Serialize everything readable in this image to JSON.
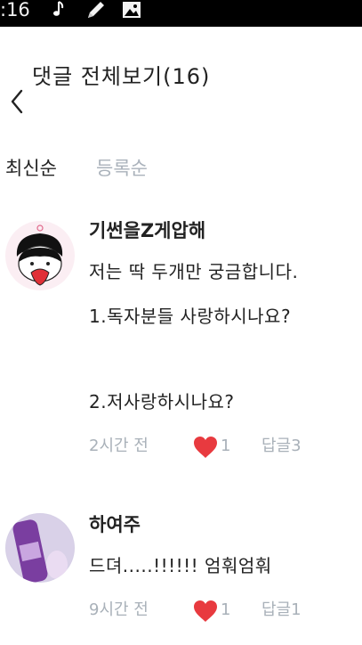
{
  "status_bar": {
    "time": ":16",
    "icons": [
      "music-note-icon",
      "pencil-icon",
      "image-icon"
    ]
  },
  "header": {
    "title": "댓글 전체보기(16)",
    "back_icon": "chevron-left-icon"
  },
  "sort_tabs": {
    "latest": "최신순",
    "registered": "등록순",
    "active": "latest"
  },
  "comments": [
    {
      "author": "기썬을Z게압해",
      "lines": [
        "저는 딱 두개만 궁금합니다.",
        "1.독자분들 사랑하시나요?",
        "",
        "2.저사랑하시나요?"
      ],
      "time": "2시간 전",
      "likes": "1",
      "reply": "답글3"
    },
    {
      "author": "하여주",
      "lines": [
        "드뎌.....!!!!!! 엄훠엄훠"
      ],
      "time": "9시간 전",
      "likes": "1",
      "reply": "답글1"
    }
  ],
  "colors": {
    "heart": "#e83a3f",
    "muted": "#a9b1b9",
    "status_bar": "#000000"
  }
}
